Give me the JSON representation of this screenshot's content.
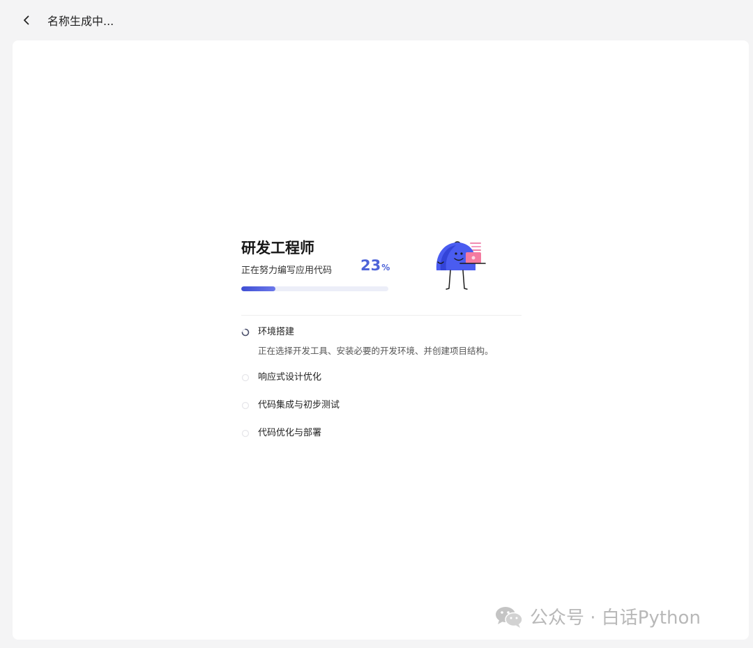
{
  "header": {
    "back_icon": "chevron-left-icon",
    "title": "名称生成中..."
  },
  "progress_card": {
    "role_title": "研发工程师",
    "status_text": "正在努力编写应用代码",
    "percent_value": "23",
    "percent_symbol": "%",
    "progress_fraction": 0.23,
    "accent_color": "#4d63d8",
    "illustration": "blue-mascot-with-laptop"
  },
  "steps": [
    {
      "label": "环境搭建",
      "description": "正在选择开发工具、安装必要的开发环境、并创建项目结构。",
      "state": "active"
    },
    {
      "label": "响应式设计优化",
      "state": "pending"
    },
    {
      "label": "代码集成与初步测试",
      "state": "pending"
    },
    {
      "label": "代码优化与部署",
      "state": "pending"
    }
  ],
  "watermark": {
    "icon": "wechat-icon",
    "text": "公众号 · 白话Python"
  }
}
